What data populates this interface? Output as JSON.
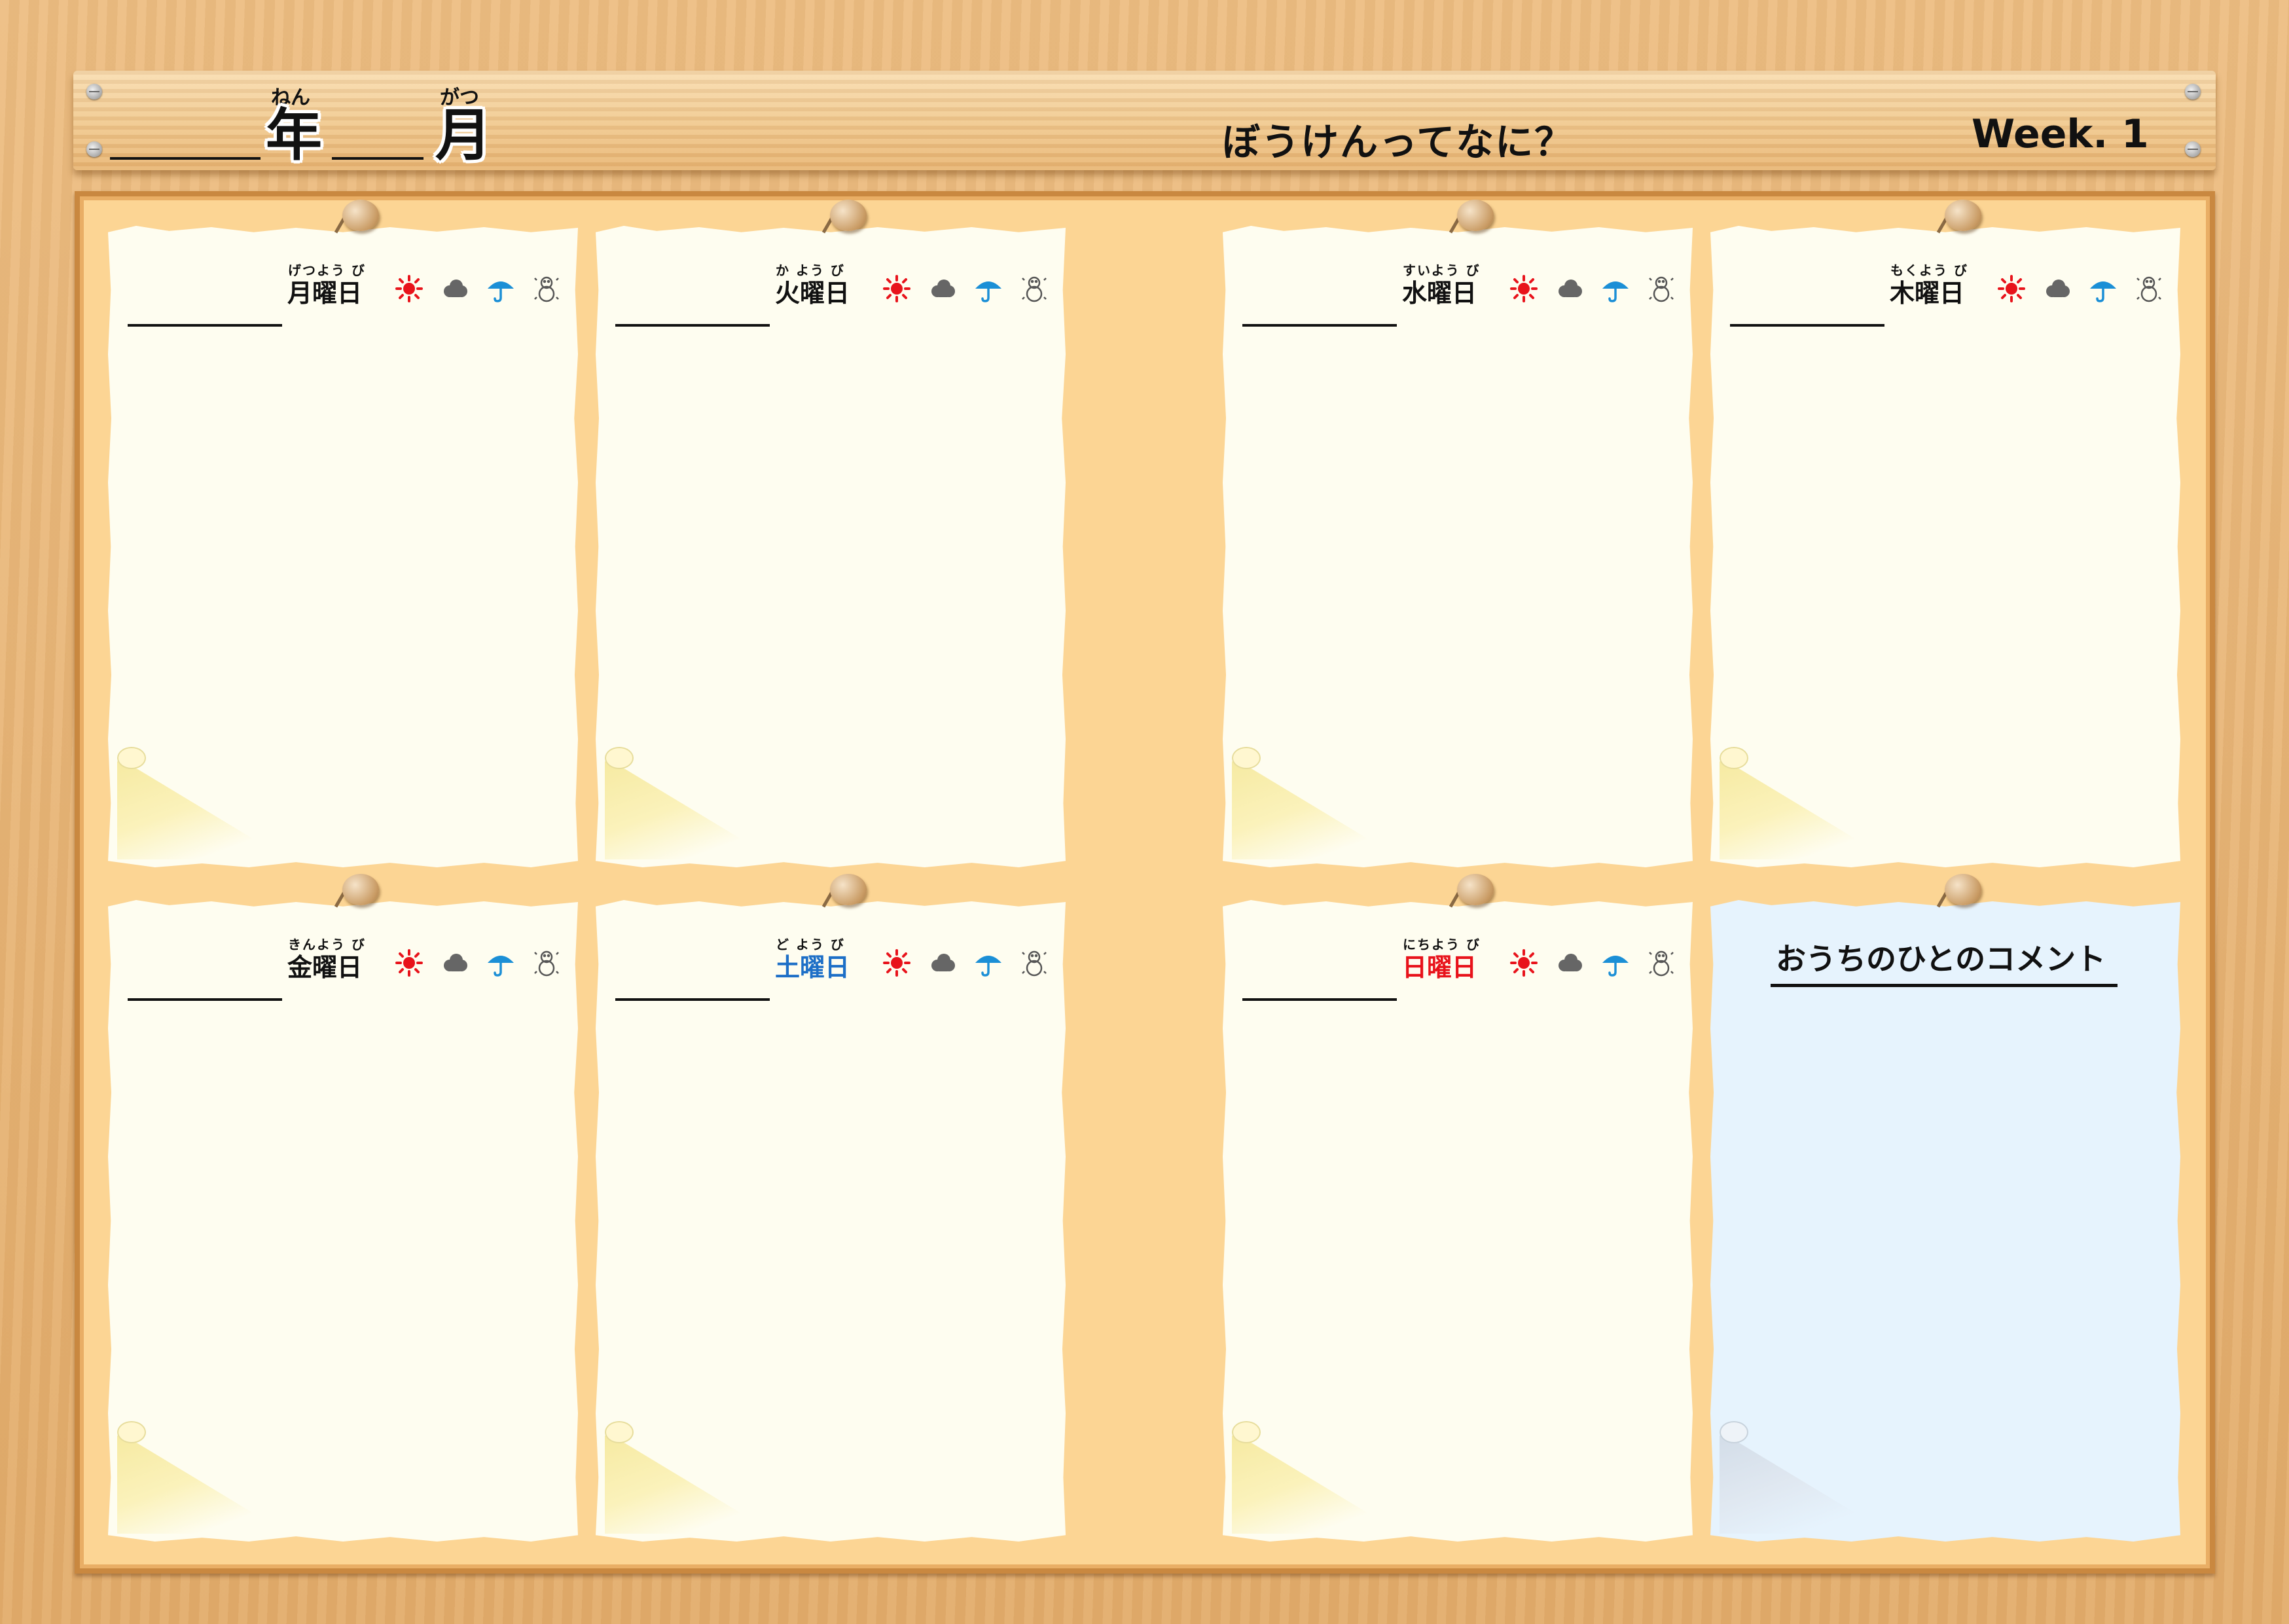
{
  "header": {
    "year_ruby": "ねん",
    "year_label": "年",
    "month_ruby": "がつ",
    "month_label": "月",
    "title": "ぼうけんってなに？",
    "week": "Week. 1"
  },
  "days": [
    {
      "ruby": "げつよう び",
      "label": "月曜日",
      "color": "#111111"
    },
    {
      "ruby": "か よう び",
      "label": "火曜日",
      "color": "#111111"
    },
    {
      "ruby": "すいよう び",
      "label": "水曜日",
      "color": "#111111"
    },
    {
      "ruby": "もくよう び",
      "label": "木曜日",
      "color": "#111111"
    },
    {
      "ruby": "きんよう び",
      "label": "金曜日",
      "color": "#111111"
    },
    {
      "ruby": "ど よう び",
      "label": "土曜日",
      "color": "#1d6fc7"
    },
    {
      "ruby": "にちよう び",
      "label": "日曜日",
      "color": "#e8131b"
    }
  ],
  "weather_icons": [
    "sun-icon",
    "cloud-icon",
    "umbrella-icon",
    "snowman-icon"
  ],
  "comment": {
    "title": "おうちのひとのコメント"
  },
  "colors": {
    "sun": "#e8131b",
    "cloud": "#666666",
    "rain": "#1b8fd6",
    "snow": "#555555",
    "board": "#fcd594",
    "paper": "#fefdf0",
    "comment_paper": "#e6f3fd"
  }
}
